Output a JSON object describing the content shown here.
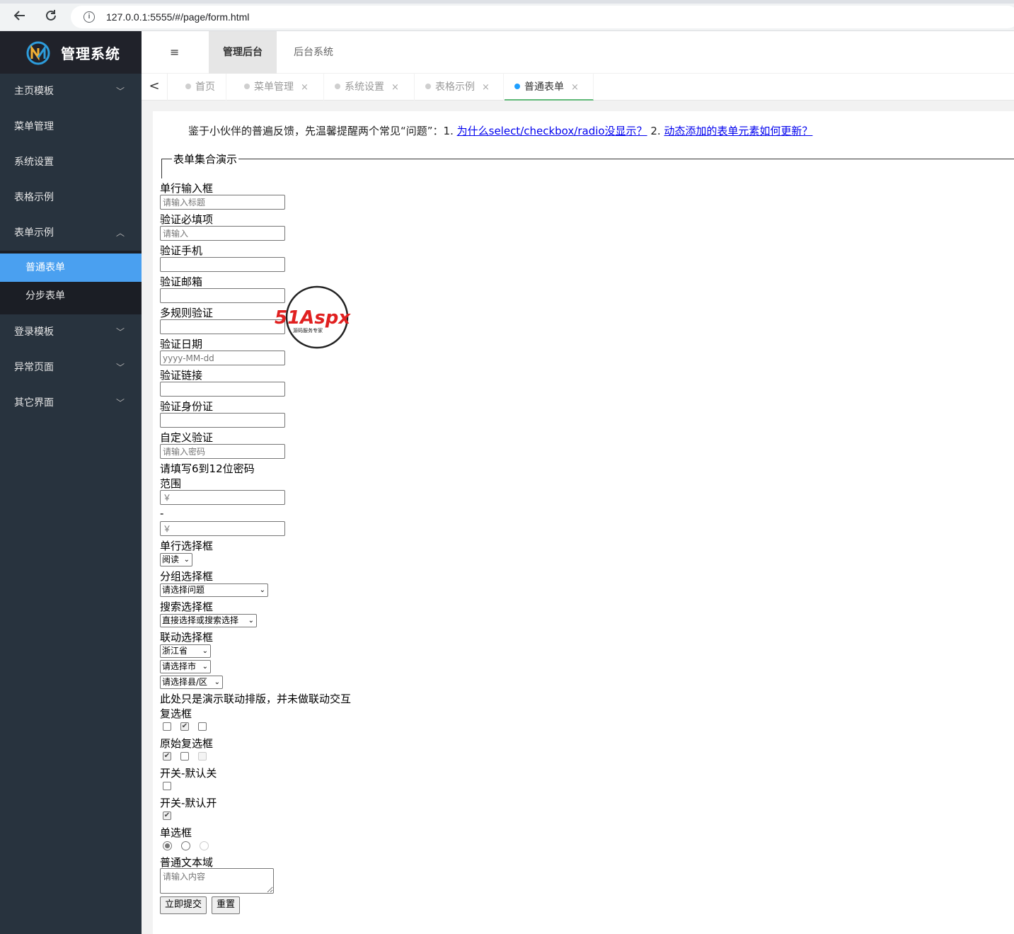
{
  "browser": {
    "url": "127.0.0.1:5555/#/page/form.html",
    "info_glyph": "i"
  },
  "sidebar": {
    "app_title": "管理系统",
    "items": [
      {
        "label": "主页模板",
        "expandable": true
      },
      {
        "label": "菜单管理",
        "expandable": false
      },
      {
        "label": "系统设置",
        "expandable": false
      },
      {
        "label": "表格示例",
        "expandable": false
      },
      {
        "label": "表单示例",
        "expandable": true,
        "expanded": true
      },
      {
        "label": "登录模板",
        "expandable": true
      },
      {
        "label": "异常页面",
        "expandable": true
      },
      {
        "label": "其它界面",
        "expandable": true
      }
    ],
    "submenu": [
      {
        "label": "普通表单",
        "active": true
      },
      {
        "label": "分步表单",
        "active": false
      }
    ],
    "colors": {
      "bg": "#28333e",
      "logo_bg": "#20222a",
      "active": "#4aa0f0"
    }
  },
  "header": {
    "toggle_glyph": "≡",
    "tabs": [
      {
        "label": "管理后台",
        "active": true
      },
      {
        "label": "后台系统",
        "active": false
      }
    ]
  },
  "tabbar": {
    "back_glyph": "<",
    "tabs": [
      {
        "label": "首页",
        "closable": false,
        "active": false
      },
      {
        "label": "菜单管理",
        "closable": true,
        "active": false
      },
      {
        "label": "系统设置",
        "closable": true,
        "active": false
      },
      {
        "label": "表格示例",
        "closable": true,
        "active": false
      },
      {
        "label": "普通表单",
        "closable": true,
        "active": true
      }
    ],
    "close_glyph": "×"
  },
  "notice": {
    "text": "鉴于小伙伴的普遍反馈，先温馨提醒两个常见“问题”：1. ",
    "link1": "为什么select/checkbox/radio没显示？",
    "middle": " 2. ",
    "link2": "动态添加的表单元素如何更新？"
  },
  "form": {
    "legend": "表单集合演示",
    "fields": {
      "title": {
        "label": "单行输入框",
        "placeholder": "请输入标题"
      },
      "required": {
        "label": "验证必填项",
        "placeholder": "请输入"
      },
      "phone": {
        "label": "验证手机",
        "placeholder": ""
      },
      "email": {
        "label": "验证邮箱",
        "placeholder": ""
      },
      "multi": {
        "label": "多规则验证",
        "placeholder": ""
      },
      "date": {
        "label": "验证日期",
        "placeholder": "yyyy-MM-dd"
      },
      "url": {
        "label": "验证链接",
        "placeholder": ""
      },
      "idcard": {
        "label": "验证身份证",
        "placeholder": ""
      },
      "custom": {
        "label": "自定义验证",
        "placeholder": "请输入密码",
        "hint": "请填写6到12位密码"
      },
      "range": {
        "label": "范围",
        "placeholder_min": "￥",
        "separator": "-",
        "placeholder_max": "￥"
      }
    },
    "select_single": {
      "label": "单行选择框",
      "value": "阅读"
    },
    "select_group": {
      "label": "分组选择框",
      "value": "请选择问题"
    },
    "select_search": {
      "label": "搜索选择框",
      "value": "直接选择或搜索选择"
    },
    "select_linked": {
      "label": "联动选择框",
      "province": "浙江省",
      "city": "请选择市",
      "district": "请选择县/区",
      "note": "此处只是演示联动排版，并未做联动交互"
    },
    "checkbox": {
      "label": "复选框",
      "states": [
        false,
        true,
        false
      ]
    },
    "checkbox_raw": {
      "label": "原始复选框",
      "states": [
        true,
        false,
        "disabled"
      ]
    },
    "switch_off": {
      "label": "开关-默认关",
      "checked": false
    },
    "switch_on": {
      "label": "开关-默认开",
      "checked": true
    },
    "radio": {
      "label": "单选框",
      "selected": 0,
      "disabled_index": 2
    },
    "textarea": {
      "label": "普通文本域",
      "placeholder": "请输入内容"
    },
    "buttons": {
      "submit": "立即提交",
      "reset": "重置"
    },
    "check_glyph": "✔",
    "select_arrow": "⌄"
  },
  "watermark": {
    "brand": "51Aspx",
    "tagline": "源码服务专家"
  }
}
